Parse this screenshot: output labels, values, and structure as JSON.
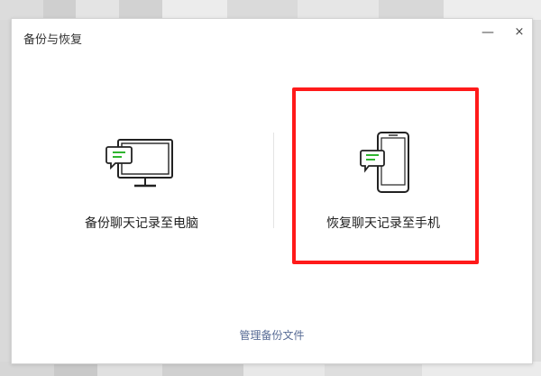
{
  "dialog": {
    "title": "备份与恢复",
    "minimize_glyph": "—",
    "close_glyph": "×"
  },
  "options": {
    "backup": {
      "label": "备份聊天记录至电脑",
      "icon": "monitor-chat-icon"
    },
    "restore": {
      "label": "恢复聊天记录至手机",
      "icon": "phone-chat-icon",
      "highlighted": true
    }
  },
  "footer": {
    "manage_label": "管理备份文件"
  },
  "colors": {
    "accent_green": "#1aad19",
    "link": "#576b95",
    "highlight": "#ff1a1a"
  }
}
